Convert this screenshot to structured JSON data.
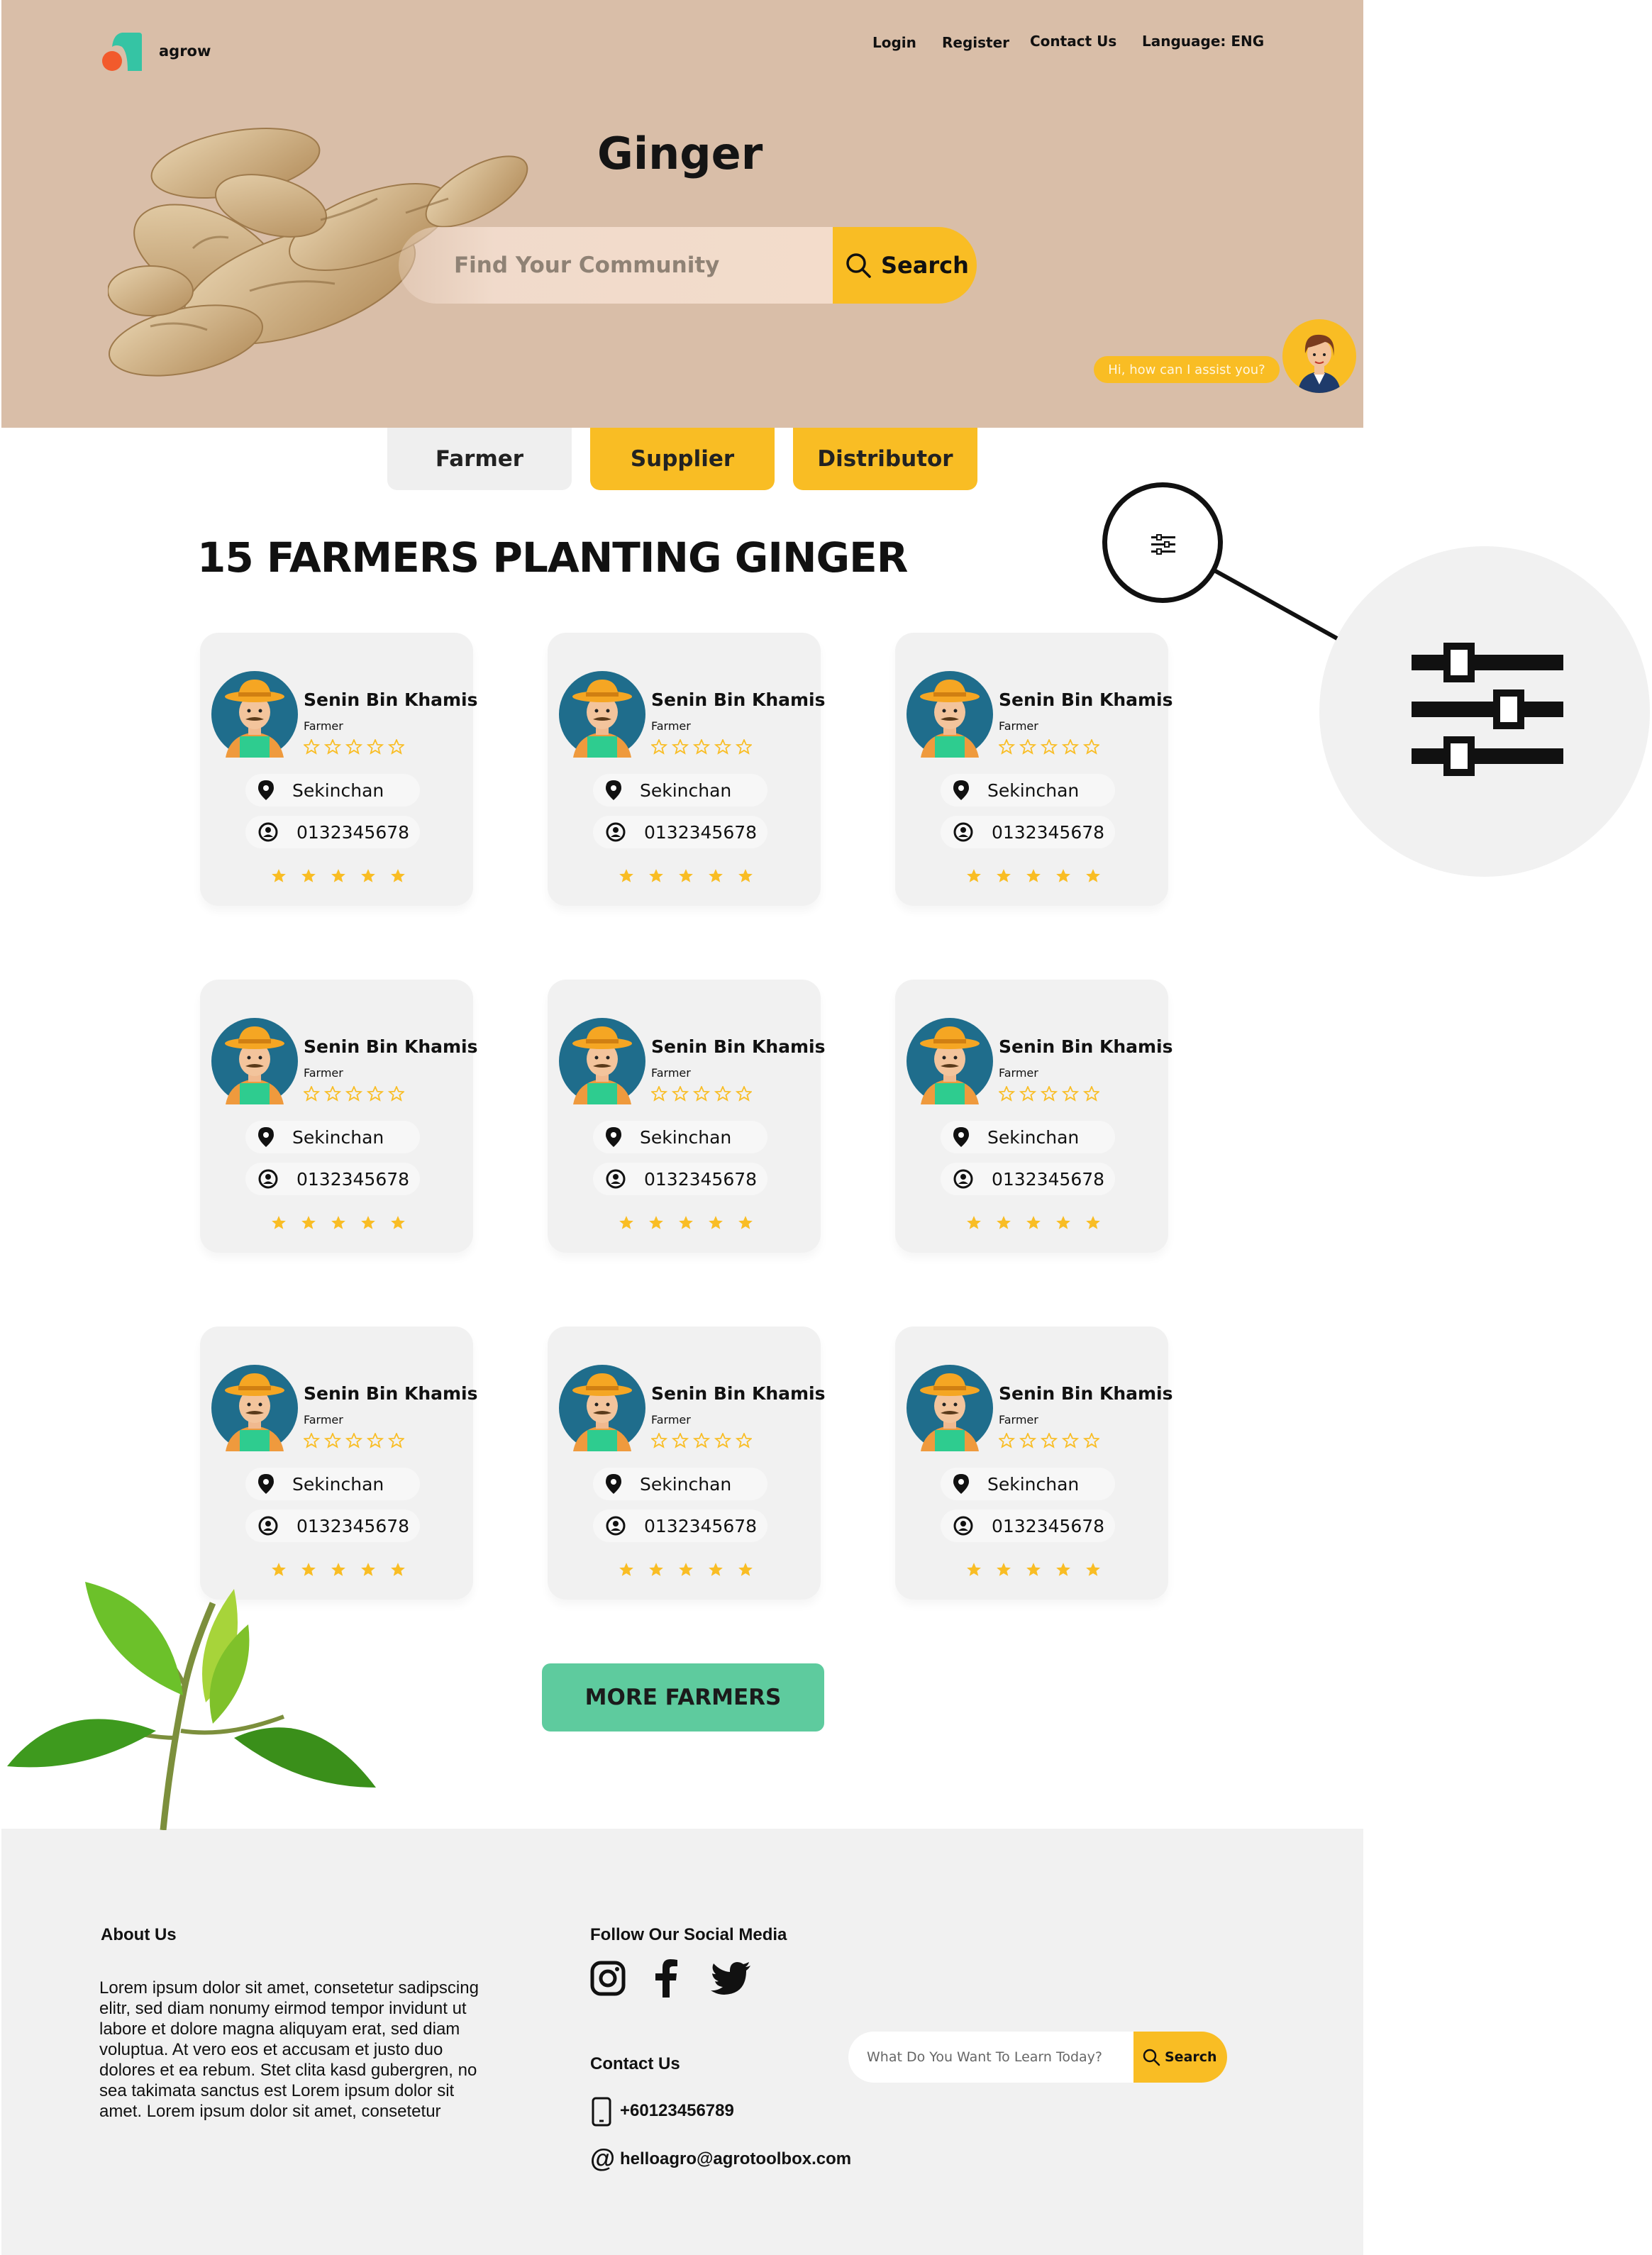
{
  "header": {
    "brand": "agrow",
    "nav": {
      "login": "Login",
      "register": "Register",
      "contact": "Contact Us",
      "language": "Language: ENG"
    }
  },
  "hero": {
    "title": "Ginger",
    "search_placeholder": "Find Your Community",
    "search_button": "Search",
    "assistant_message": "Hi, how can I assist you?"
  },
  "tabs": [
    {
      "label": "Farmer",
      "active": true
    },
    {
      "label": "Supplier",
      "active": false
    },
    {
      "label": "Distributor",
      "active": false
    }
  ],
  "section_title": "15 FARMERS PLANTING GINGER",
  "cards": [
    {
      "name": "Senin Bin Khamis",
      "role": "Farmer",
      "location": "Sekinchan",
      "phone": "0132345678"
    },
    {
      "name": "Senin Bin Khamis",
      "role": "Farmer",
      "location": "Sekinchan",
      "phone": "0132345678"
    },
    {
      "name": "Senin Bin Khamis",
      "role": "Farmer",
      "location": "Sekinchan",
      "phone": "0132345678"
    },
    {
      "name": "Senin Bin Khamis",
      "role": "Farmer",
      "location": "Sekinchan",
      "phone": "0132345678"
    },
    {
      "name": "Senin Bin Khamis",
      "role": "Farmer",
      "location": "Sekinchan",
      "phone": "0132345678"
    },
    {
      "name": "Senin Bin Khamis",
      "role": "Farmer",
      "location": "Sekinchan",
      "phone": "0132345678"
    },
    {
      "name": "Senin Bin Khamis",
      "role": "Farmer",
      "location": "Sekinchan",
      "phone": "0132345678"
    },
    {
      "name": "Senin Bin Khamis",
      "role": "Farmer",
      "location": "Sekinchan",
      "phone": "0132345678"
    },
    {
      "name": "Senin Bin Khamis",
      "role": "Farmer",
      "location": "Sekinchan",
      "phone": "0132345678"
    }
  ],
  "more_button": "MORE FARMERS",
  "footer": {
    "about_title": "About Us",
    "about_text": "Lorem ipsum dolor sit amet, consetetur sadipscing elitr, sed diam nonumy eirmod tempor invidunt ut labore et dolore magna aliquyam erat, sed diam voluptua. At vero eos et accusam et justo duo dolores et ea rebum. Stet clita kasd gubergren, no sea takimata sanctus est Lorem ipsum dolor sit amet. Lorem ipsum dolor sit amet, consetetur",
    "social_title": "Follow Our Social Media",
    "contact_title": "Contact Us",
    "phone": "+60123456789",
    "email": "helloagro@agrotoolbox.com",
    "search_placeholder": "What Do You Want To Learn Today?",
    "search_button": "Search"
  },
  "colors": {
    "accent": "#f9bd24",
    "hero_bg": "#d9bea8",
    "green": "#5ecb9e",
    "card_bg": "#f1f1f1"
  },
  "icons": [
    "search-icon",
    "location-pin-icon",
    "phone-user-icon",
    "star-icon",
    "filter-sliders-icon",
    "instagram-icon",
    "facebook-icon",
    "twitter-icon",
    "mobile-phone-icon",
    "at-icon"
  ]
}
